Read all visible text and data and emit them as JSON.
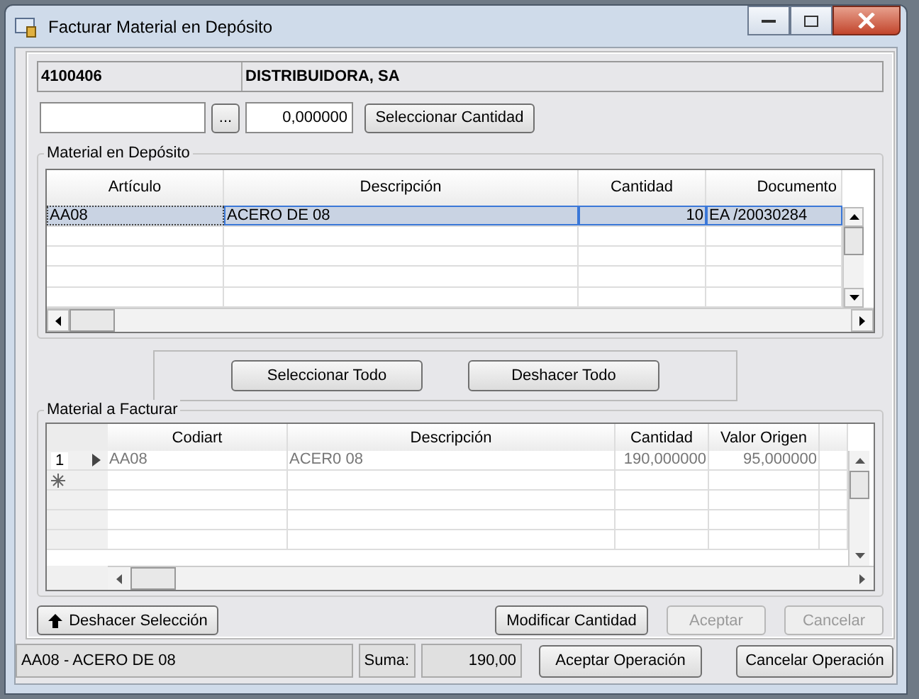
{
  "window": {
    "title": "Facturar Material en Depósito"
  },
  "customer": {
    "code": "4100406",
    "name": "DISTRIBUIDORA, SA"
  },
  "selector": {
    "browse_label": "...",
    "quantity": "0,000000",
    "select_button": "Seleccionar Cantidad"
  },
  "deposit": {
    "title": "Material en Depósito",
    "columns": [
      "Artículo",
      "Descripción",
      "Cantidad",
      "Documento"
    ],
    "rows": [
      {
        "cells": [
          "AA08",
          "ACERO DE 08",
          "10",
          "EA /20030284"
        ],
        "selected": true
      }
    ]
  },
  "bulk_buttons": [
    "Seleccionar Todo",
    "Deshacer Todo"
  ],
  "invoice": {
    "title": "Material a Facturar",
    "columns": [
      "Codiart",
      "Descripción",
      "Cantidad",
      "Valor Origen"
    ],
    "rows": [
      {
        "number": "1",
        "current": true,
        "cells": [
          "AA08",
          "ACER0 08",
          "190,000000",
          "95,000000"
        ]
      }
    ]
  },
  "undo_button": "Deshacer Selección",
  "actions": [
    {
      "label": "Modificar Cantidad",
      "disabled": false
    },
    {
      "label": "Aceptar",
      "disabled": true
    },
    {
      "label": "Cancelar",
      "disabled": true
    }
  ],
  "status": {
    "item": "AA08 - ACERO DE 08",
    "sum_label": "Suma:",
    "sum": "190,00"
  },
  "footer_buttons": [
    "Aceptar Operación",
    "Cancelar Operación"
  ]
}
